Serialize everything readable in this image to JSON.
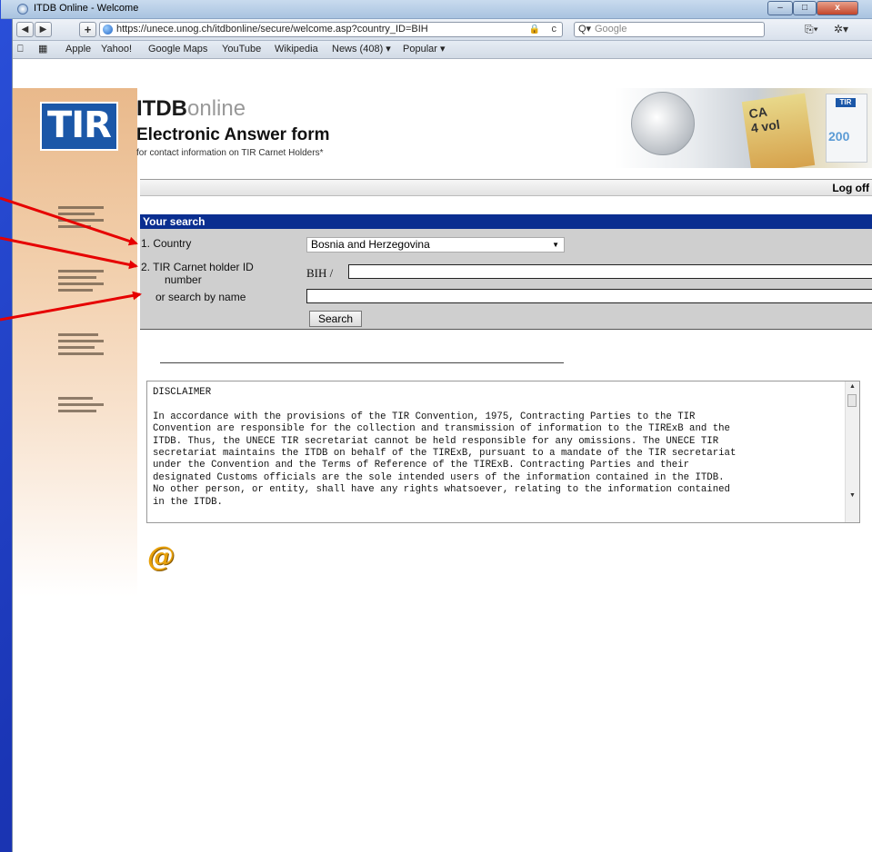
{
  "window": {
    "title": "ITDB Online - Welcome",
    "minimize": "–",
    "maximize": "□",
    "close": "x"
  },
  "navbar": {
    "back": "◀",
    "forward": "▶",
    "add": "+",
    "url": "https://unece.unog.ch/itdbonline/secure/welcome.asp?country_ID=BIH",
    "lock": "🔒",
    "reload": "c",
    "search_prefix": "Q▾",
    "search_placeholder": "Google",
    "page_menu": "⎘▾",
    "settings": "✲▾"
  },
  "bookmarks": {
    "book_icon": "⎕",
    "grid_icon": "▦",
    "items": [
      "Apple",
      "Yahoo!",
      "Google Maps",
      "YouTube",
      "Wikipedia",
      "News (408) ▾",
      "Popular ▾"
    ]
  },
  "header": {
    "logo": "TIR",
    "app_name_bold": "ITDB",
    "app_name_light": "online",
    "form_title": "Electronic Answer form",
    "form_subtitle": "for contact information on TIR Carnet Holders*",
    "carnet_text": "CA\n4 vol",
    "badge_text": "TIR",
    "badge_number": "200"
  },
  "logoff": "Log off",
  "search": {
    "heading": "Your search",
    "country_label": "1. Country",
    "country_value": "Bosnia and Herzegovina",
    "holder_label_line1": "2. TIR Carnet holder ID",
    "holder_label_line2": "number",
    "prefix": "BIH /",
    "name_label": "or search by name",
    "button": "Search"
  },
  "disclaimer": {
    "text": "DISCLAIMER\n\nIn accordance with the provisions of the TIR Convention, 1975, Contracting Parties to the TIR\nConvention are responsible for the collection and transmission of information to the TIRExB and the\nITDB. Thus, the UNECE TIR secretariat cannot be held responsible for any omissions. The UNECE TIR\nsecretariat maintains the ITDB on behalf of the TIRExB, pursuant to a mandate of the TIR secretariat\nunder the Convention and the Terms of Reference of the TIRExB. Contracting Parties and their\ndesignated Customs officials are the sole intended users of the information contained in the ITDB.\nNo other person, or entity, shall have any rights whatsoever, relating to the information contained\nin the ITDB."
  },
  "email_icon": "@",
  "colors": {
    "slide_background": "#1f3fbf",
    "search_header": "#0a2e90",
    "arrow": "#e60000"
  }
}
